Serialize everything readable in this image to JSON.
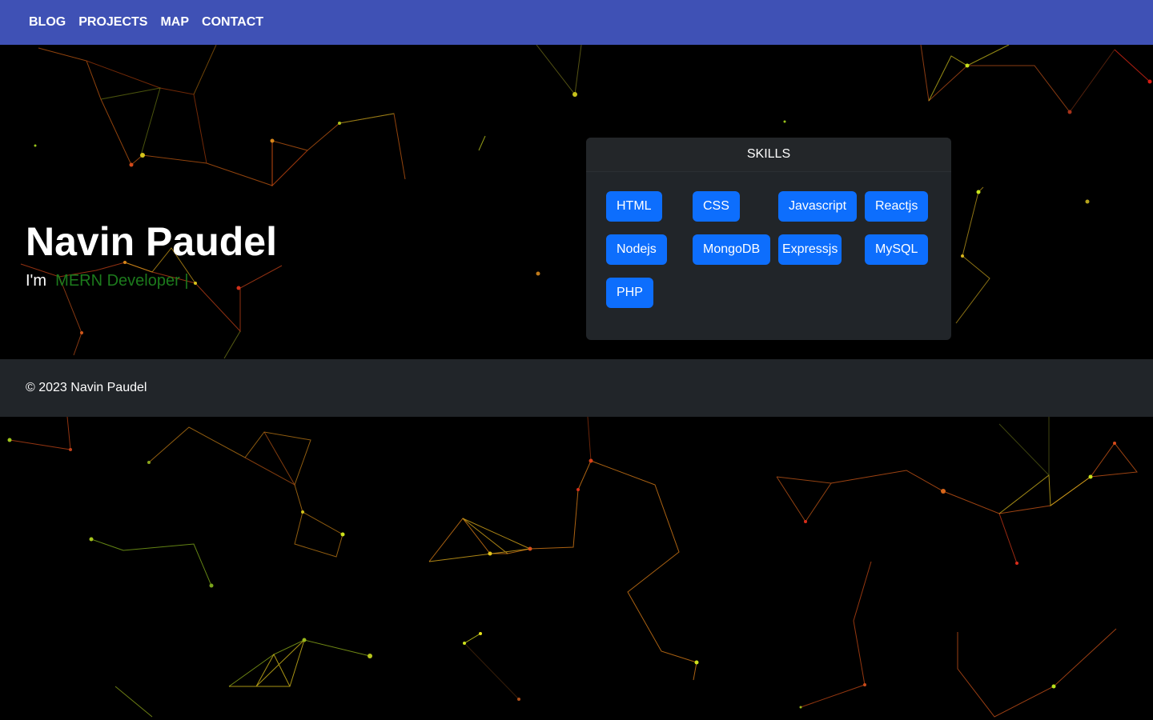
{
  "nav": {
    "items": [
      "BLOG",
      "PROJECTS",
      "MAP",
      "CONTACT"
    ],
    "background": "#3f51b5"
  },
  "hero": {
    "name": "Navin Paudel",
    "prefix": "I'm",
    "role": "MERN Developer",
    "cursor": "|",
    "role_color": "#1c7a1c"
  },
  "skills": {
    "title": "SKILLS",
    "items": [
      "HTML",
      "CSS",
      "Javascript",
      "Reactjs",
      "Nodejs",
      "MongoDB",
      "Expressjs",
      "MySQL",
      "PHP"
    ],
    "button_color": "#0d6efd"
  },
  "footer": {
    "text": "© 2023 Navin Paudel"
  }
}
